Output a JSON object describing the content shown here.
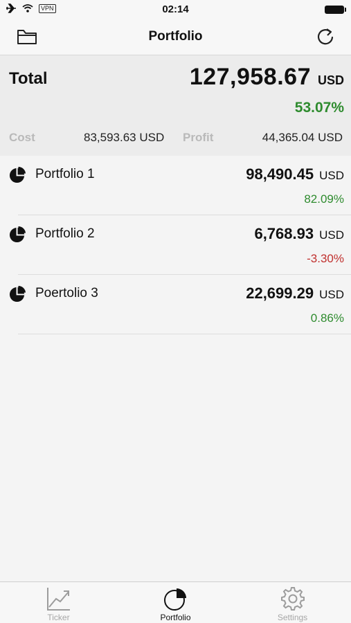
{
  "status_bar": {
    "vpn": "VPN",
    "time": "02:14"
  },
  "nav": {
    "title": "Portfolio",
    "left_icon": "folder-icon",
    "right_icon": "refresh-icon"
  },
  "summary": {
    "total_label": "Total",
    "total_value": "127,958.67",
    "total_currency": "USD",
    "total_percent": "53.07%",
    "cost_label": "Cost",
    "cost_value": "83,593.63 USD",
    "profit_label": "Profit",
    "profit_value": "44,365.04 USD"
  },
  "portfolios": [
    {
      "name": "Portfolio 1",
      "value": "98,490.45",
      "currency": "USD",
      "percent": "82.09%"
    },
    {
      "name": "Portfolio 2",
      "value": "6,768.93",
      "currency": "USD",
      "percent": "-3.30%"
    },
    {
      "name": "Poertolio 3",
      "value": "22,699.29",
      "currency": "USD",
      "percent": "0.86%"
    }
  ],
  "colors": {
    "positive": "#2e8b2e",
    "negative": "#c0302e"
  },
  "tabs": [
    {
      "label": "Ticker",
      "icon": "chart-line-icon",
      "active": false
    },
    {
      "label": "Portfolio",
      "icon": "pie-chart-icon",
      "active": true
    },
    {
      "label": "Settings",
      "icon": "gear-icon",
      "active": false
    }
  ]
}
